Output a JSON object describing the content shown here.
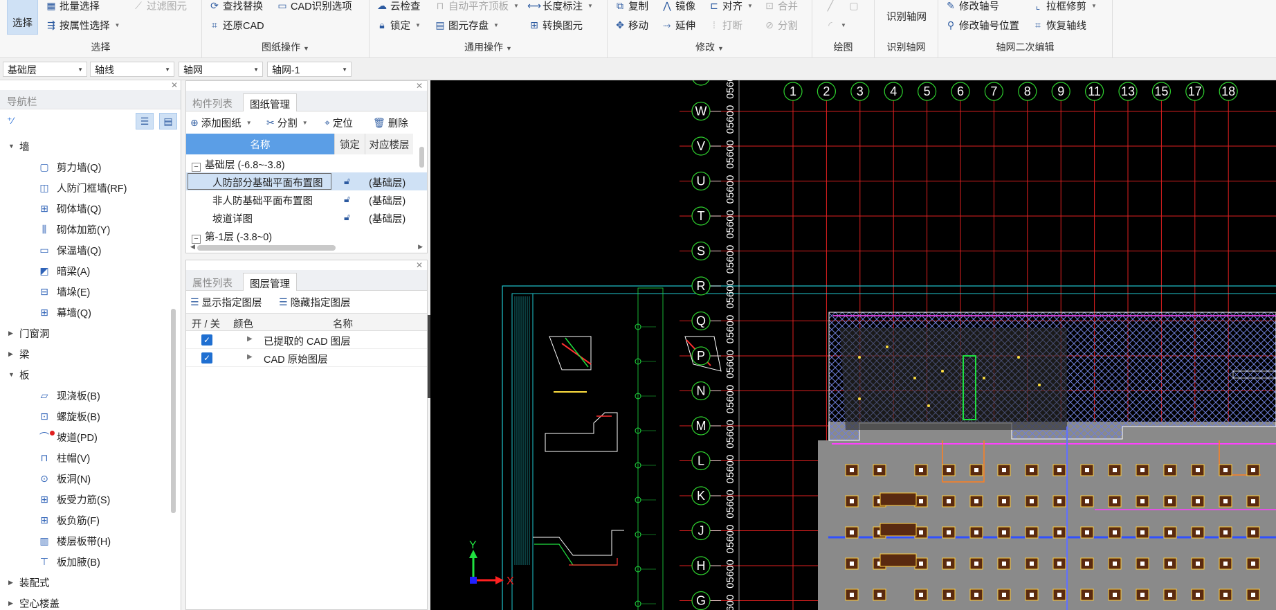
{
  "ribbon": {
    "select_group": {
      "select_label": "选择",
      "batch_select": "批量选择",
      "filter_select": "过滤图元",
      "attr_select": "按属性选择",
      "group_label": "选择"
    },
    "drawing_ops": {
      "find_replace": "查找替换",
      "cad_options": "CAD识别选项",
      "restore_cad": "还原CAD",
      "group_label": "图纸操作"
    },
    "common_ops": {
      "cloud_check": "云检查",
      "auto_align": "自动平齐顶板",
      "length_dim": "长度标注",
      "lock": "锁定",
      "element_save": "图元存盘",
      "convert": "转换图元",
      "group_label": "通用操作"
    },
    "modify": {
      "copy": "复制",
      "mirror": "镜像",
      "align": "对齐",
      "merge": "合并",
      "move": "移动",
      "extend": "延伸",
      "break": "打断",
      "split": "分割",
      "group_label": "修改"
    },
    "draw": {
      "group_label": "绘图"
    },
    "identify": {
      "button": "识别轴网",
      "group_label": "识别轴网"
    },
    "axis_edit": {
      "modify_axis_no": "修改轴号",
      "box_trim": "拉框修剪",
      "modify_axis_pos": "修改轴号位置",
      "restore_axis": "恢复轴线",
      "group_label": "轴网二次编辑"
    }
  },
  "selectors": {
    "floor": "基础层",
    "category": "轴线",
    "type": "轴网",
    "item": "轴网-1"
  },
  "nav": {
    "title": "导航栏",
    "tree": [
      {
        "kind": "cat",
        "label": "墙",
        "open": true
      },
      {
        "kind": "leaf",
        "label": "剪力墙(Q)",
        "icon": "shear-wall-icon"
      },
      {
        "kind": "leaf",
        "label": "人防门框墙(RF)",
        "icon": "door-frame-wall-icon"
      },
      {
        "kind": "leaf",
        "label": "砌体墙(Q)",
        "icon": "masonry-wall-icon"
      },
      {
        "kind": "leaf",
        "label": "砌体加筋(Y)",
        "icon": "masonry-rebar-icon"
      },
      {
        "kind": "leaf",
        "label": "保温墙(Q)",
        "icon": "insulation-wall-icon"
      },
      {
        "kind": "leaf",
        "label": "暗梁(A)",
        "icon": "hidden-beam-icon"
      },
      {
        "kind": "leaf",
        "label": "墙垛(E)",
        "icon": "wall-pier-icon"
      },
      {
        "kind": "leaf",
        "label": "幕墙(Q)",
        "icon": "curtain-wall-icon"
      },
      {
        "kind": "cat",
        "label": "门窗洞",
        "open": false
      },
      {
        "kind": "cat",
        "label": "梁",
        "open": false
      },
      {
        "kind": "cat",
        "label": "板",
        "open": true
      },
      {
        "kind": "leaf",
        "label": "现浇板(B)",
        "icon": "cast-slab-icon"
      },
      {
        "kind": "leaf",
        "label": "螺旋板(B)",
        "icon": "spiral-slab-icon"
      },
      {
        "kind": "leaf",
        "label": "坡道(PD)",
        "icon": "ramp-icon"
      },
      {
        "kind": "leaf",
        "label": "柱帽(V)",
        "icon": "column-cap-icon"
      },
      {
        "kind": "leaf",
        "label": "板洞(N)",
        "icon": "slab-hole-icon"
      },
      {
        "kind": "leaf",
        "label": "板受力筋(S)",
        "icon": "slab-main-rebar-icon"
      },
      {
        "kind": "leaf",
        "label": "板负筋(F)",
        "icon": "slab-neg-rebar-icon"
      },
      {
        "kind": "leaf",
        "label": "楼层板带(H)",
        "icon": "slab-strip-icon"
      },
      {
        "kind": "leaf",
        "label": "板加腋(B)",
        "icon": "slab-haunch-icon"
      },
      {
        "kind": "cat",
        "label": "装配式",
        "open": false
      },
      {
        "kind": "cat",
        "label": "空心楼盖",
        "open": false
      }
    ]
  },
  "drawing_panel": {
    "tabs": [
      "构件列表",
      "图纸管理"
    ],
    "toolbar": {
      "add": "添加图纸",
      "split": "分割",
      "locate": "定位",
      "delete": "删除"
    },
    "headers": {
      "name": "名称",
      "lock": "锁定",
      "floor": "对应楼层"
    },
    "rows": [
      {
        "type": "group",
        "name": "基础层 (-6.8~-3.8)"
      },
      {
        "type": "item",
        "name": "人防部分基础平面布置图",
        "floor": "(基础层)",
        "selected": true
      },
      {
        "type": "item",
        "name": "非人防基础平面布置图",
        "floor": "(基础层)"
      },
      {
        "type": "item",
        "name": "坡道详图",
        "floor": "(基础层)"
      },
      {
        "type": "group",
        "name": "第-1层 (-3.8~0)"
      }
    ]
  },
  "layer_panel": {
    "tabs": [
      "属性列表",
      "图层管理"
    ],
    "toolbar": {
      "show": "显示指定图层",
      "hide": "隐藏指定图层"
    },
    "headers": {
      "toggle": "开 / 关",
      "color": "颜色",
      "name": "名称"
    },
    "rows": [
      {
        "name": "已提取的 CAD 图层",
        "on": true
      },
      {
        "name": "CAD 原始图层",
        "on": true
      }
    ]
  },
  "cad": {
    "col_axes": [
      "1",
      "2",
      "3",
      "4",
      "5",
      "6",
      "7",
      "8",
      "9",
      "11",
      "13",
      "15",
      "17",
      "18"
    ],
    "row_axes": [
      "X",
      "W",
      "V",
      "U",
      "T",
      "S",
      "R",
      "Q",
      "P",
      "N",
      "M",
      "L",
      "K",
      "J",
      "H",
      "G"
    ],
    "dim_text": "05600",
    "ucs_x": "X",
    "ucs_y": "Y",
    "colors": {
      "bg": "#000000",
      "grid": "#e02020",
      "bubble": "#2fd22f",
      "hatch": "#6f7fd8",
      "slab": "#8a8a8a",
      "frame": "#20c8d0"
    }
  }
}
